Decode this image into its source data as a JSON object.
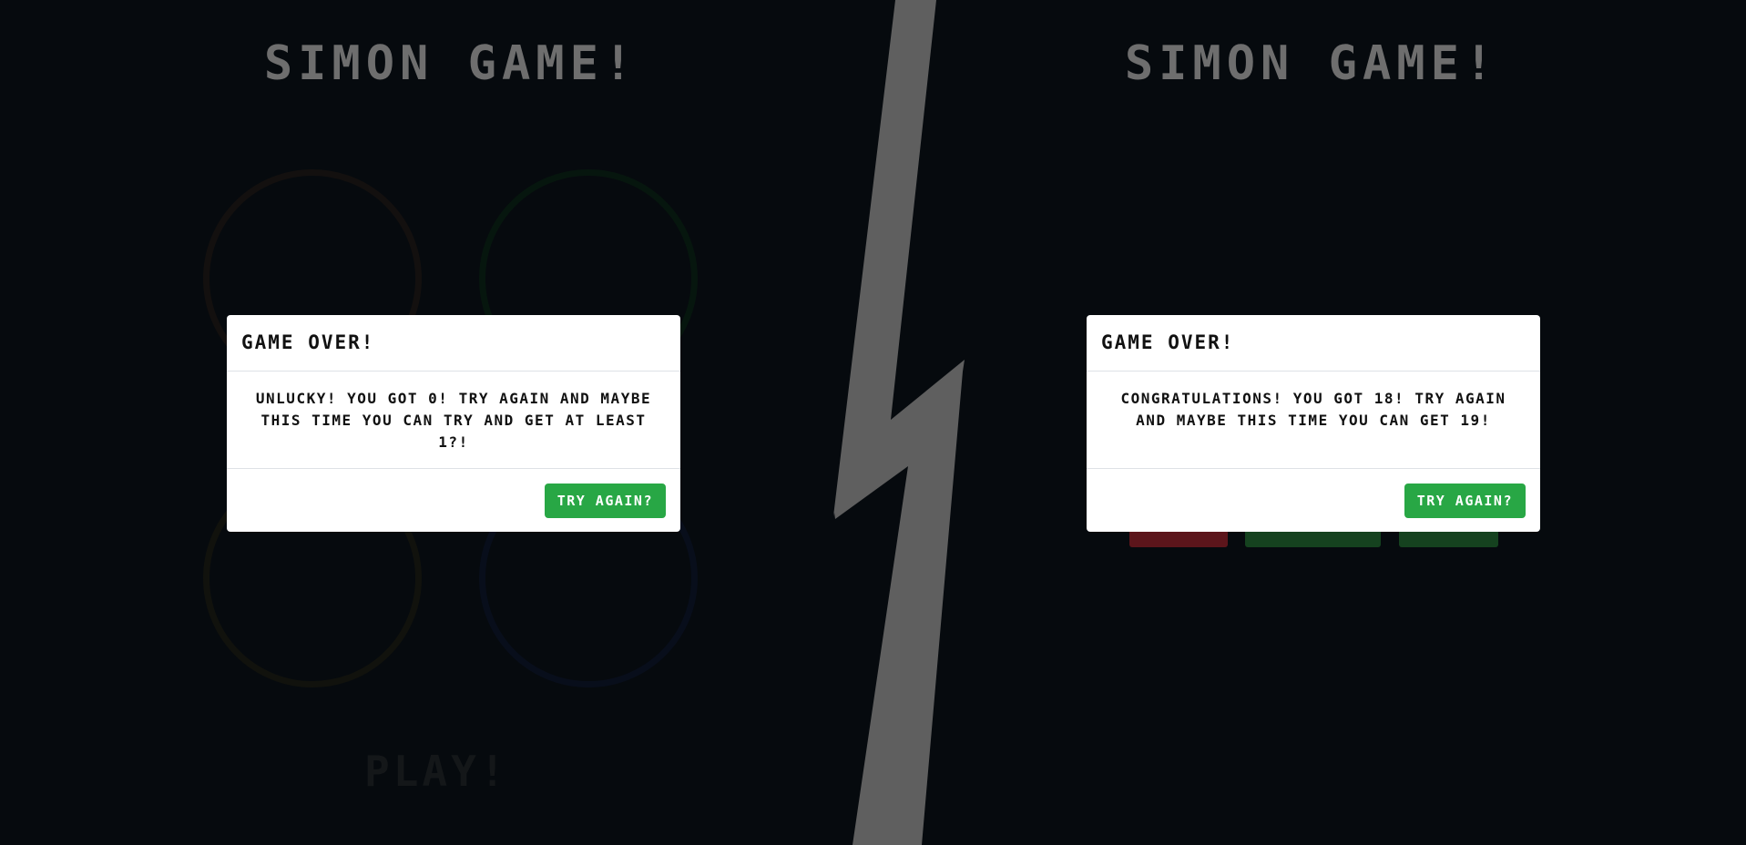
{
  "colors": {
    "background": "#060a0e",
    "title_gray": "#6e6e6e",
    "bolt_gray": "#5f5f5f",
    "success_green": "#28a745",
    "modal_bg": "#ffffff"
  },
  "left_panel": {
    "title": "SIMON GAME!",
    "play_label": "PLAY!",
    "modal": {
      "title": "GAME OVER!",
      "message": "UNLUCKY! YOU GOT 0! TRY AGAIN AND MAYBE THIS TIME YOU CAN TRY AND GET AT LEAST 1?!",
      "button_label": "TRY AGAIN?"
    }
  },
  "right_panel": {
    "title": "SIMON GAME!",
    "modal": {
      "title": "GAME OVER!",
      "message": "CONGRATULATIONS! YOU GOT 18! TRY AGAIN AND MAYBE THIS TIME YOU CAN GET 19!",
      "button_label": "TRY AGAIN?"
    }
  }
}
